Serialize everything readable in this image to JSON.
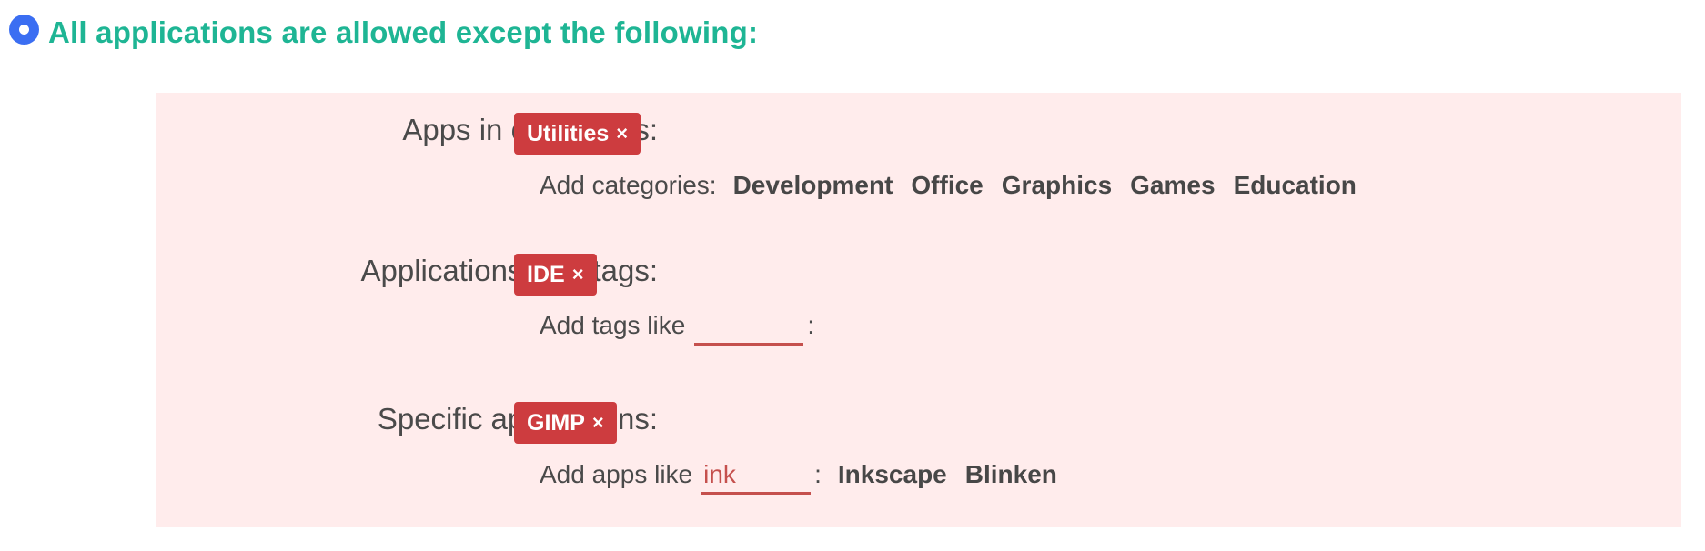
{
  "heading": {
    "label": "All applications are allowed except the following:",
    "radio_selected": true,
    "accent_color": "#1eb594",
    "radio_color": "#3b6ef2"
  },
  "panel": {
    "background": "#ffecec",
    "chip_color": "#cd3c3f",
    "categories": {
      "label": "Apps in categories:",
      "chips": [
        {
          "label": "Utilities",
          "remove": "×"
        }
      ],
      "add_label": "Add categories:",
      "options": [
        "Development",
        "Office",
        "Graphics",
        "Games",
        "Education"
      ]
    },
    "tags": {
      "label": "Applications with tags:",
      "chips": [
        {
          "label": "IDE",
          "remove": "×"
        }
      ],
      "add_label": "Add tags like",
      "input_value": "",
      "colon": ":"
    },
    "apps": {
      "label": "Specific applications:",
      "chips": [
        {
          "label": "GIMP",
          "remove": "×"
        }
      ],
      "add_label": "Add apps like",
      "input_value": "ink",
      "colon": ":",
      "suggestions": [
        "Inkscape",
        "Blinken"
      ]
    }
  }
}
